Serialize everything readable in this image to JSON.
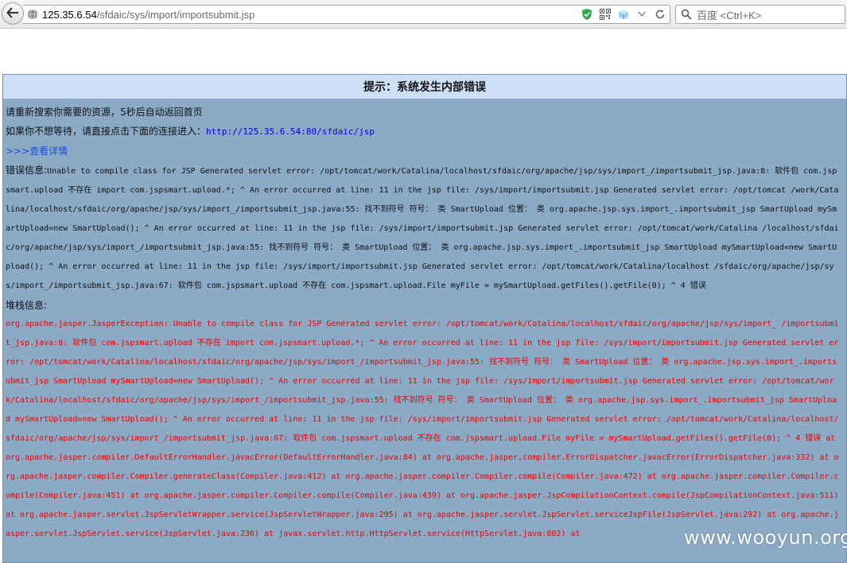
{
  "browser": {
    "url_host": "125.35.6.54",
    "url_path": "/sfdaic/sys/import/importsubmit.jsp",
    "search_placeholder": "百度 <Ctrl+K>"
  },
  "panel": {
    "title": "提示：系统发生内部错误",
    "line1": "请重新搜索你需要的资源，5秒后自动返回首页",
    "line2_prefix": "如果你不想等待，请直接点击下面的连接进入：",
    "line2_link": "http://125.35.6.54:80/sfdaic/jsp",
    "details_arrows": ">>>",
    "details_link": "查看详情",
    "error_label": "错误信息:",
    "error_text": "Unable to compile class for JSP Generated servlet error: /opt/tomcat/work/Catalina/localhost/sfdaic/org/apache/jsp/sys/import_/importsubmit_jsp.java:8: 软件包 com.jspsmart.upload 不存在 import com.jspsmart.upload.*; ^ An error occurred at line: 11 in the jsp file: /sys/import/importsubmit.jsp Generated servlet error: /opt/tomcat /work/Catalina/localhost/sfdaic/org/apache/jsp/sys/import_/importsubmit_jsp.java:55: 找不到符号 符号： 类 SmartUpload 位置： 类 org.apache.jsp.sys.import_.importsubmit_jsp SmartUpload mySmartUpload=new SmartUpload(); ^ An error occurred at line: 11 in the jsp file: /sys/import/importsubmit.jsp Generated servlet error: /opt/tomcat/work/Catalina /localhost/sfdaic/org/apache/jsp/sys/import_/importsubmit_jsp.java:55: 找不到符号 符号： 类 SmartUpload 位置： 类 org.apache.jsp.sys.import_.importsubmit_jsp SmartUpload mySmartUpload=new SmartUpload(); ^ An error occurred at line: 11 in the jsp file: /sys/import/importsubmit.jsp Generated servlet error: /opt/tomcat/work/Catalina/localhost /sfdaic/org/apache/jsp/sys/import_/importsubmit_jsp.java:67: 软件包 com.jspsmart.upload 不存在 com.jspsmart.upload.File myFile = mySmartUpload.getFiles().getFile(0); ^ 4 错误",
    "stack_label": "堆栈信息:",
    "stack_text": "org.apache.jasper.JasperException: Unable to compile class for JSP Generated servlet error: /opt/tomcat/work/Catalina/localhost/sfdaic/org/apache/jsp/sys/import_ /importsubmit_jsp.java:8: 软件包 com.jspsmart.upload 不存在 import com.jspsmart.upload.*; ^ An error occurred at line: 11 in the jsp file: /sys/import/importsubmit.jsp Generated servlet error: /opt/tomcat/work/Catalina/localhost/sfdaic/org/apache/jsp/sys/import_/importsubmit_jsp.java:55: 找不到符号 符号： 类 SmartUpload 位置： 类 org.apache.jsp.sys.import_.importsubmit_jsp SmartUpload mySmartUpload=new SmartUpload(); ^ An error occurred at line: 11 in the jsp file: /sys/import/importsubmit.jsp Generated servlet error: /opt/tomcat/work/Catalina/localhost/sfdaic/org/apache/jsp/sys/import_/importsubmit_jsp.java:55: 找不到符号 符号： 类 SmartUpload 位置： 类 org.apache.jsp.sys.import_.importsubmit_jsp SmartUpload mySmartUpload=new SmartUpload(); ^ An error occurred at line: 11 in the jsp file: /sys/import/importsubmit.jsp Generated servlet error: /opt/tomcat/work/Catalina/localhost/sfdaic/org/apache/jsp/sys/import_/importsubmit_jsp.java:67: 软件包 com.jspsmart.upload 不存在 com.jspsmart.upload.File myFile = mySmartUpload.getFiles().getFile(0); ^ 4 错误 at org.apache.jasper.compiler.DefaultErrorHandler.javacError(DefaultErrorHandler.java:84) at org.apache.jasper.compiler.ErrorDispatcher.javacError(ErrorDispatcher.java:332) at org.apache.jasper.compiler.Compiler.generateClass(Compiler.java:412) at org.apache.jasper.compiler.Compiler.compile(Compiler.java:472) at org.apache.jasper.compiler.Compiler.compile(Compiler.java:451) at org.apache.jasper.compiler.Compiler.compile(Compiler.java:439) at org.apache.jasper.JspCompilationContext.compile(JspCompilationContext.java:511) at org.apache.jasper.servlet.JspServletWrapper.service(JspServletWrapper.java:295) at org.apache.jasper.servlet.JspServlet.serviceJspFile(JspServlet.java:292) at org.apache.jasper.servlet.JspServlet.service(JspServlet.java:236) at javax.servlet.http.HttpServlet.service(HttpServlet.java:802) at"
  },
  "watermark": "www.wooyun.org",
  "colors": {
    "panel_bg": "#8aaac6",
    "header_bg": "#ccdff6",
    "stack_text": "#ee0000",
    "link": "#0000ee"
  }
}
